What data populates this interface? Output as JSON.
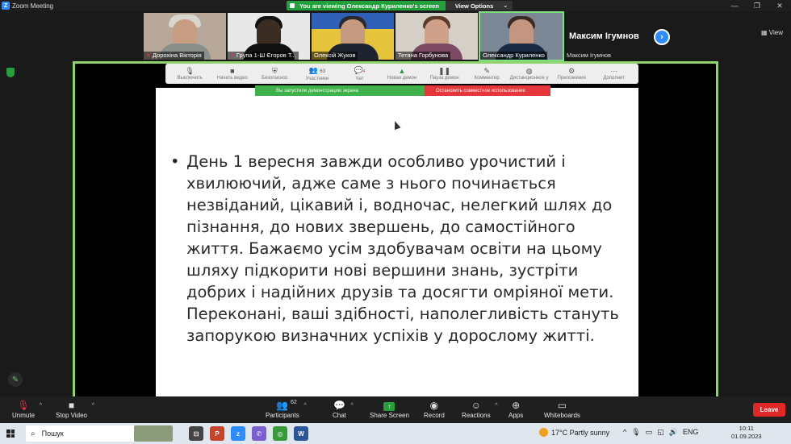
{
  "window": {
    "title": "Zoom Meeting",
    "share_banner": "You are viewing Олександр Куриленко's screen",
    "view_options": "View Options",
    "view_button": "View"
  },
  "participants": [
    {
      "name": "Дорохіна Вікторія",
      "muted": true
    },
    {
      "name": "Група 1-Ш Єгоров Т...",
      "muted": true
    },
    {
      "name": "Олексій Жуков",
      "muted": false
    },
    {
      "name": "Тетяна Горбунова",
      "muted": false
    },
    {
      "name": "Олександр Куриленко",
      "muted": false
    },
    {
      "name": "Максим Ігумнов",
      "muted": false
    }
  ],
  "featured_name": "Максим Ігумнов",
  "presenter_toolbar": {
    "items": [
      "Выключить",
      "Начать видео",
      "Безопаснос",
      "Участники",
      "Чат",
      "Новая демон",
      "Пауза демон",
      "Комментир",
      "Дистанционное у",
      "Приложения",
      "Дополнит"
    ],
    "participants_count": "63",
    "chat_badge": "4",
    "share_notice": "Вы запустили демонстрацию экрана",
    "stop_share": "Остановить совместное использование"
  },
  "slide": {
    "bullet": "•",
    "text": "День 1 вересня завжди особливо урочистий і хвилюючий, адже саме з нього починається незвіданий, цікавий і, водночас, нелегкий шлях до пізнання, до нових звершень, до самостійного життя. Бажаємо усім здобувачам освіти на цьому шляху підкорити нові вершини знань, зустріти добрих і надійних друзів та досягти омріяної мети. Переконані, ваші здібності, наполегливість стануть запорукою визначних успіхів у дорослому житті."
  },
  "toolbar": {
    "unmute": "Unmute",
    "stop_video": "Stop Video",
    "participants": "Participants",
    "participants_count": "62",
    "chat": "Chat",
    "share_screen": "Share Screen",
    "record": "Record",
    "reactions": "Reactions",
    "apps": "Apps",
    "whiteboards": "Whiteboards",
    "leave": "Leave"
  },
  "taskbar": {
    "search_placeholder": "Пошук",
    "weather": "17°C  Partly sunny",
    "language": "ENG",
    "time": "10:11",
    "date": "01.09.2023"
  },
  "colors": {
    "accent": "#2d8cff",
    "share_green": "#23a03b",
    "leave_red": "#e02828"
  }
}
